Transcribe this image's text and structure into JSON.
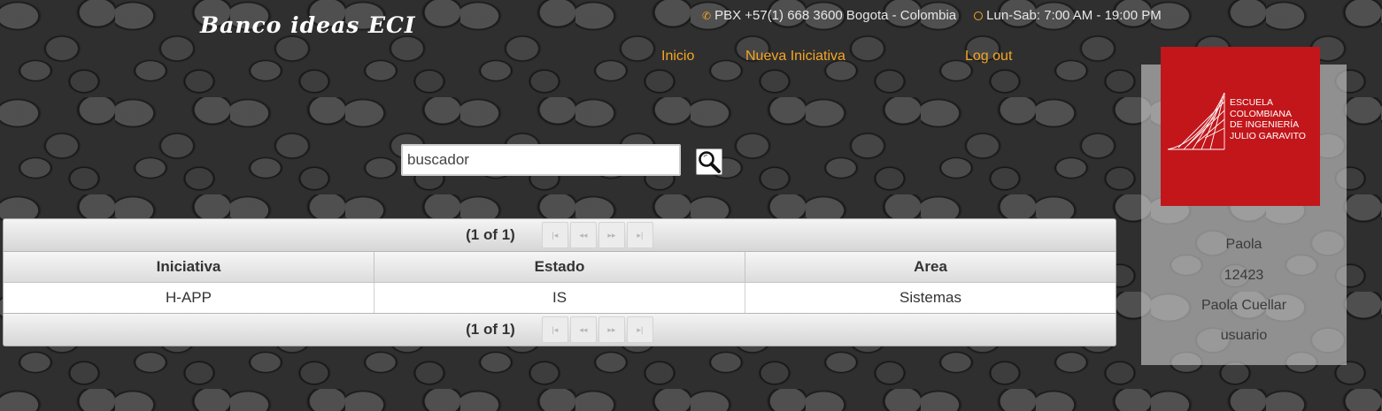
{
  "header": {
    "brand": "Banco ideas ECI",
    "phone": "PBX +57(1) 668 3600 Bogota - Colombia",
    "hours": "Lun-Sab: 7:00 AM - 19:00 PM",
    "phone_icon": "phone-icon",
    "clock_icon": "clock-icon"
  },
  "nav": {
    "inicio": "Inicio",
    "nueva_iniciativa": "Nueva Iniciativa",
    "logout": "Log out"
  },
  "search": {
    "placeholder": "buscador",
    "value": "",
    "button_icon": "search-icon"
  },
  "table": {
    "page_report_top": "(1 of 1)",
    "page_report_bottom": "(1 of 1)",
    "paginator_buttons": [
      "first-page-icon",
      "prev-page-icon",
      "next-page-icon",
      "last-page-icon"
    ],
    "columns": [
      "Iniciativa",
      "Estado",
      "Area"
    ],
    "rows": [
      [
        "H-APP",
        "IS",
        "Sistemas"
      ]
    ]
  },
  "logo": {
    "lines": [
      "Escuela",
      "Colombiana",
      "de Ingeniería",
      "Julio Garavito"
    ],
    "color": "#c2161b"
  },
  "profile": {
    "name": "Paola",
    "id": "12423",
    "full_name": "Paola Cuellar",
    "role": "usuario"
  },
  "colors": {
    "accent": "#f5a623",
    "brand_red": "#c2161b"
  }
}
